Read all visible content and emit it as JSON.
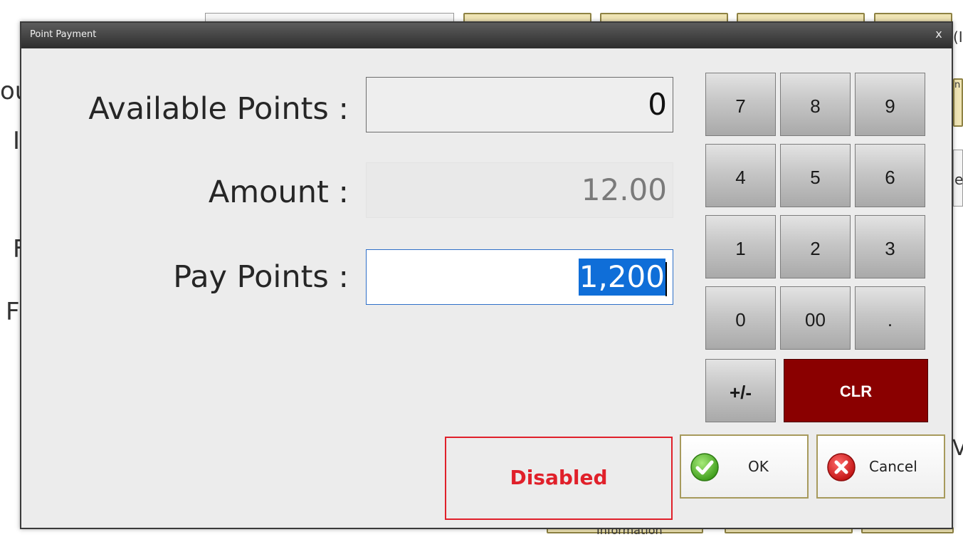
{
  "dialog": {
    "title": "Point Payment",
    "close_glyph": "x"
  },
  "fields": {
    "available_points": {
      "label": "Available Points :",
      "value": "0"
    },
    "amount": {
      "label": "Amount :",
      "value": "12.00"
    },
    "pay_points": {
      "label": "Pay Points :",
      "value": "1,200"
    }
  },
  "keypad": {
    "keys": [
      "7",
      "8",
      "9",
      "4",
      "5",
      "6",
      "1",
      "2",
      "3",
      "0",
      "00",
      ".",
      "+/-"
    ],
    "clear_label": "CLR"
  },
  "status": {
    "disabled_label": "Disabled"
  },
  "actions": {
    "ok_label": "OK",
    "cancel_label": "Cancel"
  },
  "background": {
    "frag_left_1": "ou",
    "frag_left_2": "I",
    "frag_left_3": "F",
    "frag_left_4": "F",
    "frag_right_1": "(I",
    "frag_right_2": "n",
    "frag_right_3": "e",
    "frag_right_4": "V",
    "frag_bottom_info": "Information"
  },
  "colors": {
    "clear_key": "#8a0000",
    "disabled": "#e0202a",
    "selection": "#0f6ed8"
  }
}
